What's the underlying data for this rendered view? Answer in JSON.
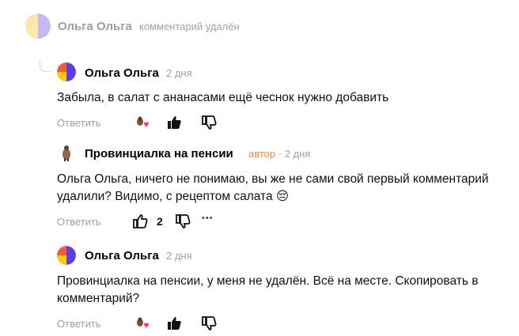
{
  "comments": [
    {
      "author": "Ольга Ольга",
      "status": "комментарий удалён"
    },
    {
      "author": "Ольга Ольга",
      "time": "2 дня",
      "text": "Забыла, в салат с ананасами ещё чеснок нужно добавить",
      "reply_label": "Ответить"
    },
    {
      "author": "Провинциалка на пенсии",
      "badge": "автор",
      "separator": "·",
      "time": "2 дня",
      "text": "Ольга Ольга, ничего не понимаю, вы же не сами свой первый комментарий удалили? Видимо, с рецептом салата 😔",
      "reply_label": "Ответить",
      "likes": "2",
      "more": "•••"
    },
    {
      "author": "Ольга Ольга",
      "time": "2 дня",
      "text": "Провинциалка на пенсии, у меня не удалён. Всё на месте. Скопировать в комментарий?",
      "reply_label": "Ответить"
    }
  ],
  "icons": [
    "avatar-icon",
    "reaction-icon",
    "like-icon",
    "dislike-icon",
    "more-icon"
  ],
  "colors": {
    "grey": "#9da1a8",
    "author_badge": "#f08a4b"
  }
}
